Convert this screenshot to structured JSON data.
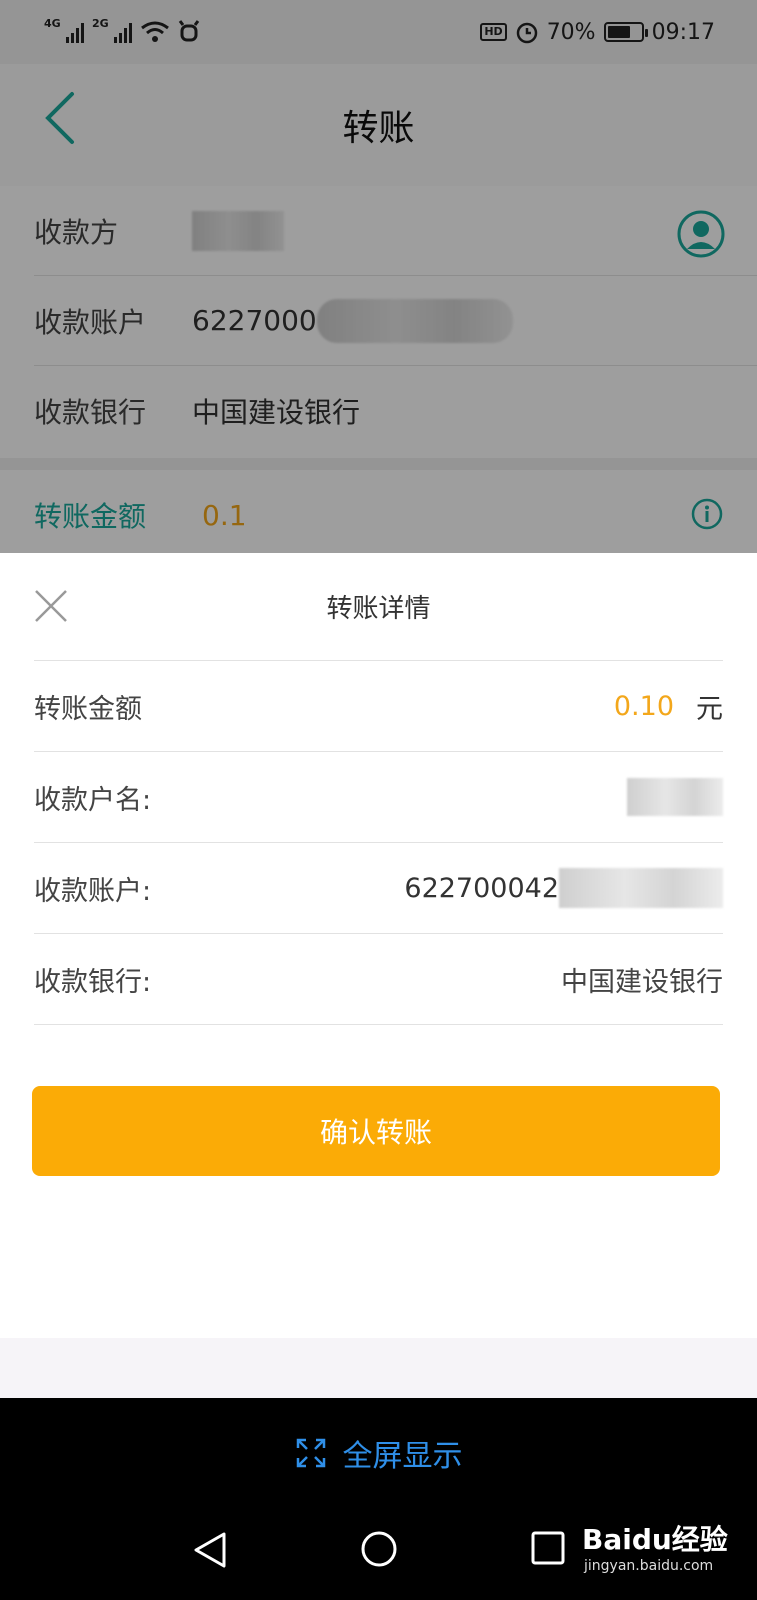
{
  "status_bar": {
    "signal1": "4G",
    "signal2": "2G",
    "hd": "HD",
    "battery": "70%",
    "time": "09:17"
  },
  "nav": {
    "title": "转账"
  },
  "payee": {
    "payee_label": "收款方",
    "account_label": "收款账户",
    "account_value": "6227000",
    "bank_label": "收款银行",
    "bank_value": "中国建设银行"
  },
  "amount": {
    "label": "转账金额",
    "value": "0.1"
  },
  "sheet": {
    "title": "转账详情",
    "amount_label": "转账金额",
    "amount_value": "0.10",
    "amount_unit": "元",
    "name_label": "收款户名:",
    "account_label": "收款账户:",
    "account_value": "622700042",
    "bank_label": "收款银行:",
    "bank_value": "中国建设银行",
    "confirm_label": "确认转账"
  },
  "fullscreen": {
    "label": "全屏显示"
  },
  "watermark": {
    "brand": "Baidu经验",
    "url": "jingyan.baidu.com"
  },
  "colors": {
    "accent_teal": "#1aa89c",
    "amount_orange": "#f3a71b",
    "button_orange": "#fbab06",
    "link_blue": "#2f8fe8"
  },
  "icons": [
    "back-arrow-icon",
    "avatar-icon",
    "info-icon",
    "close-icon",
    "fullscreen-icon",
    "nav-back-icon",
    "nav-home-icon",
    "nav-recent-icon"
  ]
}
